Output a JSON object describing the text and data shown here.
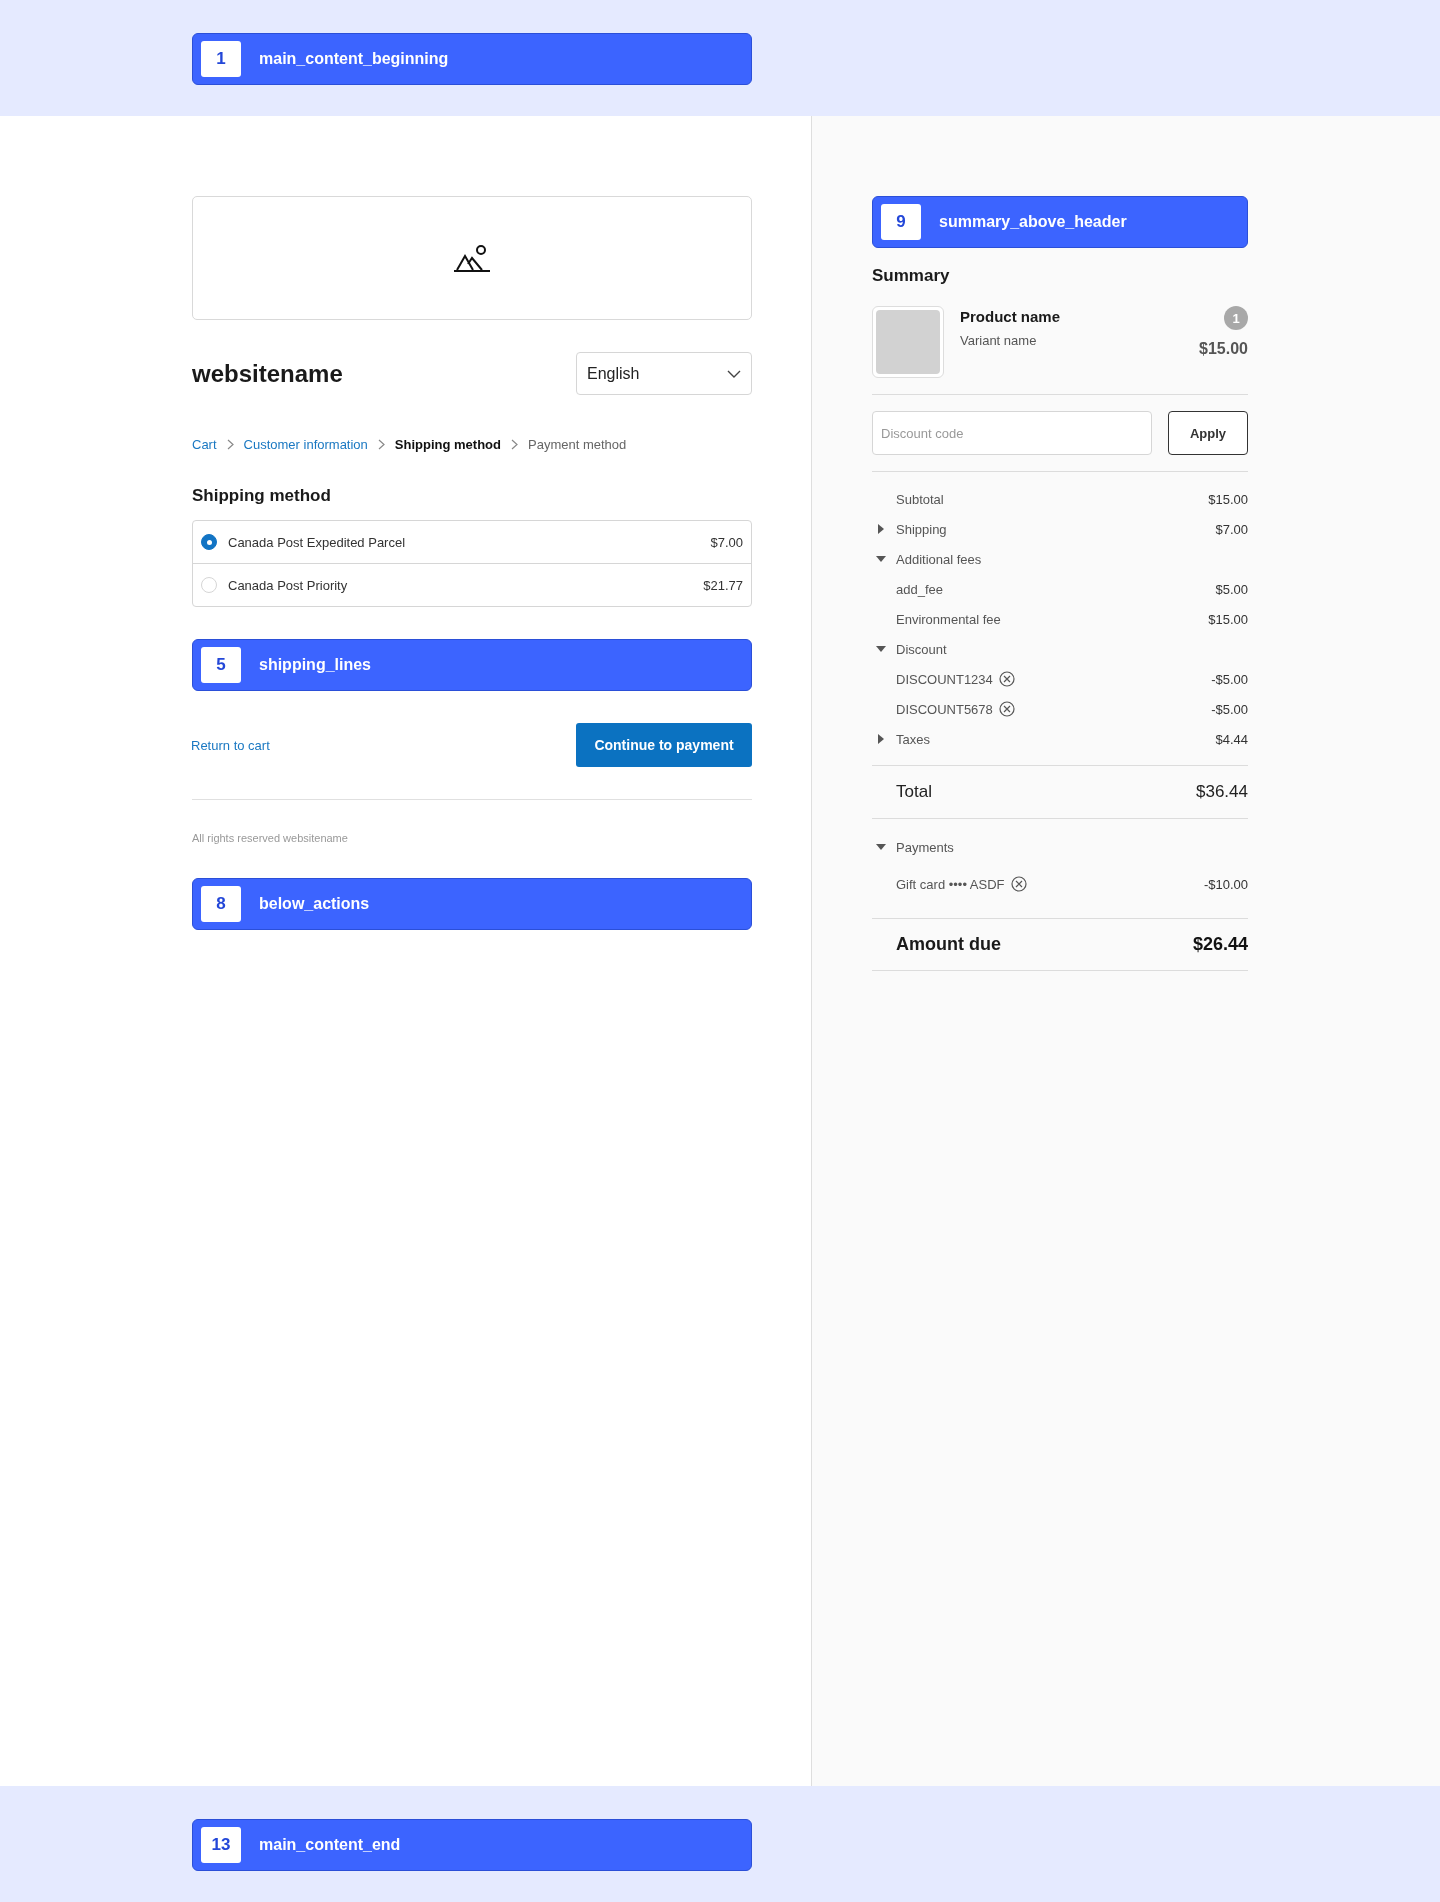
{
  "top_slot": {
    "number": "1",
    "label": "main_content_beginning"
  },
  "store": {
    "name": "websitename",
    "language": "English"
  },
  "breadcrumbs": [
    {
      "label": "Cart",
      "kind": "link"
    },
    {
      "label": "Customer information",
      "kind": "link"
    },
    {
      "label": "Shipping method",
      "kind": "current"
    },
    {
      "label": "Payment method",
      "kind": "upcoming"
    }
  ],
  "shipping": {
    "title": "Shipping method",
    "options": [
      {
        "name": "Canada Post Expedited Parcel",
        "price": "$7.00",
        "selected": true
      },
      {
        "name": "Canada Post Priority",
        "price": "$21.77",
        "selected": false
      }
    ]
  },
  "shipping_slot": {
    "number": "5",
    "label": "shipping_lines"
  },
  "actions": {
    "return_link": "Return to cart",
    "continue_button": "Continue to payment"
  },
  "footer": {
    "text": "All rights reserved websitename"
  },
  "below_actions_slot": {
    "number": "8",
    "label": "below_actions"
  },
  "summary": {
    "header_slot": {
      "number": "9",
      "label": "summary_above_header"
    },
    "title": "Summary",
    "items": [
      {
        "name": "Product name",
        "variant": "Variant name",
        "quantity": "1",
        "price": "$15.00"
      }
    ],
    "discount": {
      "placeholder": "Discount code",
      "button": "Apply"
    },
    "lines": [
      {
        "kind": "line",
        "label": "Subtotal",
        "amount": "$15.00"
      },
      {
        "kind": "group",
        "label": "Shipping",
        "amount": "$7.00",
        "expanded": false
      },
      {
        "kind": "group",
        "label": "Additional fees",
        "expanded": true,
        "children": [
          {
            "label": "add_fee",
            "amount": "$5.00",
            "removable": false
          },
          {
            "label": "Environmental fee",
            "amount": "$15.00",
            "removable": false
          }
        ]
      },
      {
        "kind": "group",
        "label": "Discount",
        "expanded": true,
        "children": [
          {
            "label": "DISCOUNT1234",
            "amount": "-$5.00",
            "removable": true
          },
          {
            "label": "DISCOUNT5678",
            "amount": "-$5.00",
            "removable": true
          }
        ]
      },
      {
        "kind": "group",
        "label": "Taxes",
        "amount": "$4.44",
        "expanded": false
      }
    ],
    "total": {
      "label": "Total",
      "amount": "$36.44"
    },
    "payments": {
      "label": "Payments",
      "expanded": true,
      "children": [
        {
          "label": "Gift card •••• ASDF",
          "amount": "-$10.00",
          "removable": true
        }
      ]
    },
    "amount_due": {
      "label": "Amount due",
      "amount": "$26.44"
    }
  },
  "bottom_slot": {
    "number": "13",
    "label": "main_content_end"
  }
}
